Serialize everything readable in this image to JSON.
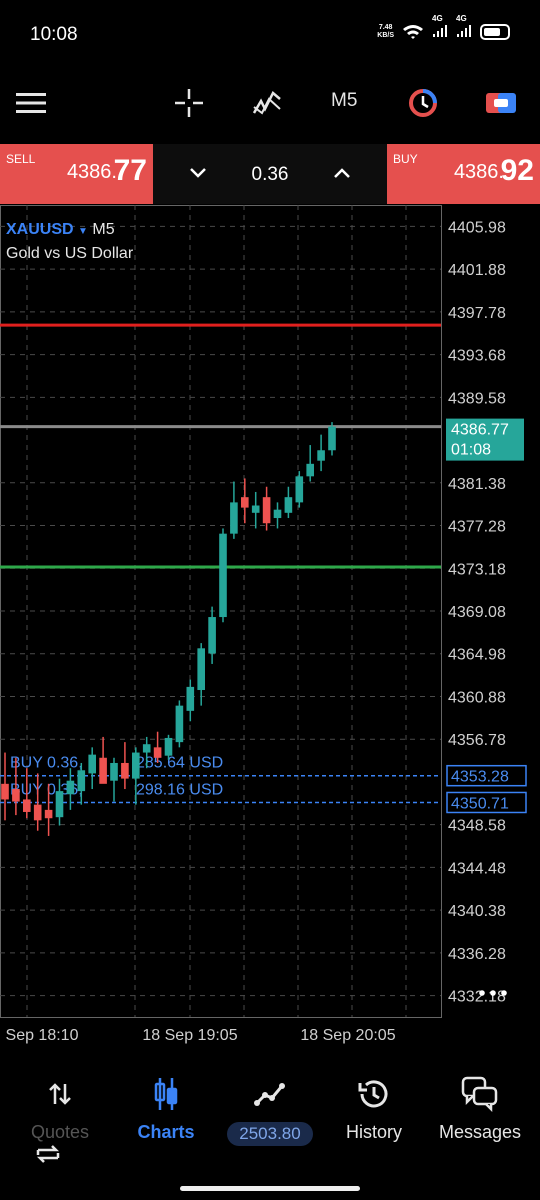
{
  "status": {
    "time": "10:08",
    "net_speed": "7.48\nKB/S",
    "sig1": "4G",
    "sig2": "4G"
  },
  "toolbar": {
    "menu_icon": "hamburger-icon",
    "crosshair_icon": "crosshair-icon",
    "indicators_icon": "indicators-icon",
    "timeframe": "M5",
    "objects_icon": "objects-icon",
    "trade_icon": "trade-icon"
  },
  "trade": {
    "sell_label": "SELL",
    "sell_price": "4386.",
    "sell_big": "77",
    "buy_label": "BUY",
    "buy_price": "4386.",
    "buy_big": "92",
    "volume": "0.36"
  },
  "chart_data": {
    "type": "candlestick",
    "symbol": "XAUUSD",
    "timeframe": "M5",
    "description": "Gold vs US Dollar",
    "y_axis_ticks": [
      "4405.98",
      "4401.88",
      "4397.78",
      "4393.68",
      "4389.58",
      "4381.38",
      "4377.28",
      "4373.18",
      "4369.08",
      "4364.98",
      "4360.88",
      "4356.78",
      "4348.58",
      "4344.48",
      "4340.38",
      "4336.28",
      "4332.18"
    ],
    "ylim": [
      4330.13,
      4408.03
    ],
    "x_axis_labels": [
      "Sep 18:10",
      "18 Sep 19:05",
      "18 Sep 20:05"
    ],
    "current_price": "4386.77",
    "countdown": "01:08",
    "levels": [
      {
        "price": 4396.5,
        "color": "#e0201e",
        "label": ""
      },
      {
        "price": 4386.77,
        "color": "#8a8a8a",
        "label": ""
      },
      {
        "price": 4373.3,
        "color": "#2ea84a",
        "label": ""
      }
    ],
    "positions": [
      {
        "label": "BUY 0.36,",
        "profit": "285.64 USD",
        "price": "4353.28"
      },
      {
        "label": "BUY 0.36,",
        "profit": "298.16 USD",
        "price": "4350.71"
      }
    ],
    "up_color": "#26a69a",
    "down_color": "#ef5350",
    "candles": [
      {
        "o": 4352.5,
        "h": 4355.5,
        "l": 4349.0,
        "c": 4351.0
      },
      {
        "o": 4352.0,
        "h": 4355.0,
        "l": 4349.5,
        "c": 4350.8
      },
      {
        "o": 4351.0,
        "h": 4354.0,
        "l": 4349.2,
        "c": 4349.8
      },
      {
        "o": 4350.5,
        "h": 4353.5,
        "l": 4348.0,
        "c": 4349.0
      },
      {
        "o": 4350.0,
        "h": 4352.5,
        "l": 4347.5,
        "c": 4349.2
      },
      {
        "o": 4349.3,
        "h": 4353.0,
        "l": 4348.5,
        "c": 4351.8
      },
      {
        "o": 4351.5,
        "h": 4354.0,
        "l": 4350.0,
        "c": 4352.8
      },
      {
        "o": 4351.8,
        "h": 4354.5,
        "l": 4350.5,
        "c": 4353.8
      },
      {
        "o": 4353.5,
        "h": 4356.0,
        "l": 4352.0,
        "c": 4355.3
      },
      {
        "o": 4355.0,
        "h": 4357.0,
        "l": 4353.0,
        "c": 4352.5
      },
      {
        "o": 4352.8,
        "h": 4355.0,
        "l": 4350.8,
        "c": 4354.5
      },
      {
        "o": 4354.5,
        "h": 4356.5,
        "l": 4352.0,
        "c": 4353.0
      },
      {
        "o": 4353.0,
        "h": 4356.0,
        "l": 4350.5,
        "c": 4355.5
      },
      {
        "o": 4355.5,
        "h": 4357.0,
        "l": 4354.0,
        "c": 4356.3
      },
      {
        "o": 4356.0,
        "h": 4357.5,
        "l": 4354.5,
        "c": 4355.0
      },
      {
        "o": 4355.2,
        "h": 4357.2,
        "l": 4354.8,
        "c": 4356.9
      },
      {
        "o": 4356.5,
        "h": 4360.5,
        "l": 4356.0,
        "c": 4360.0
      },
      {
        "o": 4359.5,
        "h": 4362.5,
        "l": 4358.5,
        "c": 4361.8
      },
      {
        "o": 4361.5,
        "h": 4366.0,
        "l": 4360.0,
        "c": 4365.5
      },
      {
        "o": 4365.0,
        "h": 4369.5,
        "l": 4364.0,
        "c": 4368.5
      },
      {
        "o": 4368.5,
        "h": 4377.0,
        "l": 4368.0,
        "c": 4376.5
      },
      {
        "o": 4376.5,
        "h": 4381.5,
        "l": 4376.0,
        "c": 4379.5
      },
      {
        "o": 4380.0,
        "h": 4381.8,
        "l": 4377.5,
        "c": 4379.0
      },
      {
        "o": 4378.5,
        "h": 4380.5,
        "l": 4377.0,
        "c": 4379.2
      },
      {
        "o": 4380.0,
        "h": 4381.0,
        "l": 4376.8,
        "c": 4377.5
      },
      {
        "o": 4378.0,
        "h": 4379.5,
        "l": 4377.0,
        "c": 4378.8
      },
      {
        "o": 4378.5,
        "h": 4381.0,
        "l": 4378.0,
        "c": 4380.0
      },
      {
        "o": 4379.5,
        "h": 4382.5,
        "l": 4379.0,
        "c": 4382.0
      },
      {
        "o": 4382.0,
        "h": 4385.0,
        "l": 4381.5,
        "c": 4383.2
      },
      {
        "o": 4383.5,
        "h": 4386.0,
        "l": 4382.5,
        "c": 4384.5
      },
      {
        "o": 4384.5,
        "h": 4387.2,
        "l": 4384.0,
        "c": 4386.77
      }
    ]
  },
  "nav": {
    "quotes": "Quotes",
    "charts": "Charts",
    "balance": "2503.80",
    "history": "History",
    "messages": "Messages"
  }
}
